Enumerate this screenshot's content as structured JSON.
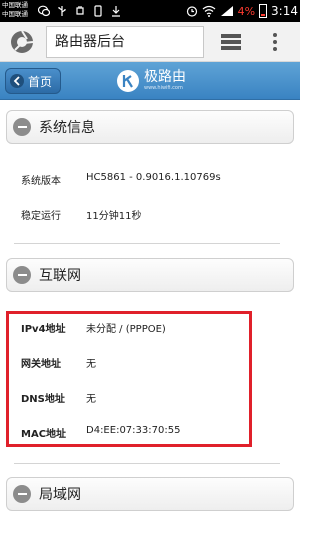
{
  "status_bar": {
    "carrier_1": "中国联通",
    "carrier_2": "中国联通",
    "battery_percent": "4%",
    "time": "3:14"
  },
  "browser": {
    "url_text": "路由器后台",
    "icons": [
      "browser-logo-icon",
      "tabs-icon",
      "menu-icon"
    ]
  },
  "app_header": {
    "home_label": "首页",
    "brand_name": "极路由",
    "brand_url": "www.hiwifi.com"
  },
  "sections": {
    "system": {
      "title": "系统信息",
      "rows": [
        {
          "label": "系统版本",
          "value": "HC5861 - 0.9016.1.10769s"
        },
        {
          "label": "稳定运行",
          "value": "11分钟11秒"
        }
      ]
    },
    "internet": {
      "title": "互联网",
      "rows": [
        {
          "label": "IPv4地址",
          "value": "未分配 / (PPPOE)"
        },
        {
          "label": "网关地址",
          "value": "无"
        },
        {
          "label": "DNS地址",
          "value": "无"
        },
        {
          "label": "MAC地址",
          "value": "D4:EE:07:33:70:55"
        }
      ]
    },
    "lan": {
      "title": "局域网"
    }
  },
  "colors": {
    "header_blue": "#3a83c2",
    "highlight_red": "#e0202a",
    "battery_red": "#ff3b30"
  }
}
